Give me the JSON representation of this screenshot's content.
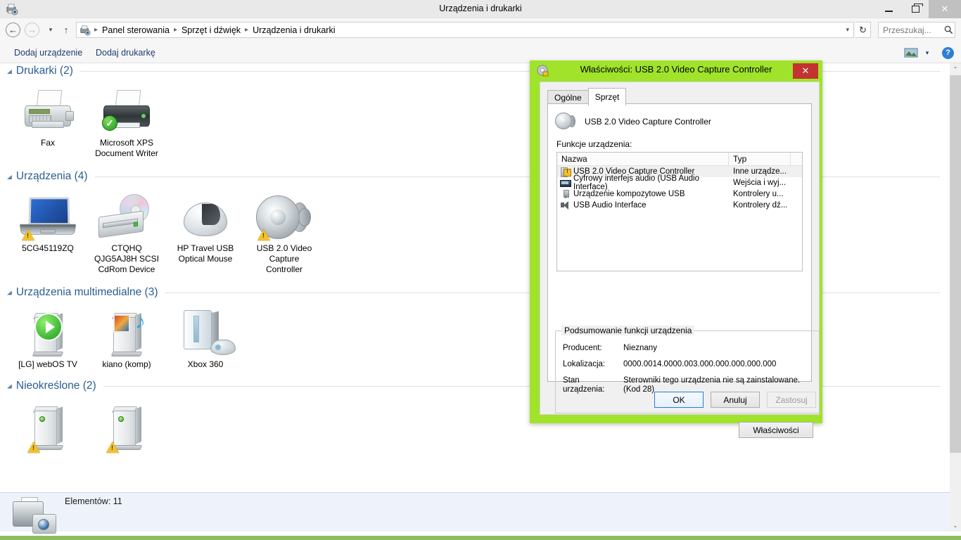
{
  "window": {
    "title": "Urządzenia i drukarki",
    "icon": "devices-printers-icon",
    "minimize": "–",
    "maximize": "❐",
    "close": "✕"
  },
  "address_bar": {
    "back": "←",
    "forward": "→",
    "recent": "▾",
    "up": "↑",
    "crumb_icon": "devices-printers-icon",
    "crumbs": [
      "Panel sterowania",
      "Sprzęt i dźwięk",
      "Urządzenia i drukarki"
    ],
    "separator": "▸",
    "dropdown_caret": "▾",
    "refresh": "↻",
    "search_placeholder": "Przeszukaj...",
    "search_value": "",
    "search_icon": "🔍"
  },
  "command_bar": {
    "add_device": "Dodaj urządzenie",
    "add_printer": "Dodaj drukarkę",
    "view_caret": "▾",
    "help": "?"
  },
  "groups": [
    {
      "title": "Drukarki (2)",
      "collapse": "◢",
      "items": [
        {
          "label": "Fax",
          "icon": "fax-printer-icon",
          "badge": "none"
        },
        {
          "label": "Microsoft XPS\nDocument Writer",
          "icon": "xps-printer-icon",
          "badge": "default-check"
        }
      ]
    },
    {
      "title": "Urządzenia (4)",
      "collapse": "◢",
      "items": [
        {
          "label": "5CG45119ZQ",
          "icon": "laptop-icon",
          "badge": "warning"
        },
        {
          "label": "CTQHQ\nQJG5AJ8H SCSI\nCdRom Device",
          "icon": "cdrom-drive-icon",
          "badge": "none"
        },
        {
          "label": "HP Travel USB\nOptical Mouse",
          "icon": "mouse-icon",
          "badge": "none"
        },
        {
          "label": "USB 2.0 Video\nCapture\nController",
          "icon": "speaker-icon",
          "badge": "warning"
        }
      ]
    },
    {
      "title": "Urządzenia multimedialne (3)",
      "collapse": "◢",
      "items": [
        {
          "label": "[LG] webOS TV",
          "icon": "media-tower-icon",
          "badge": "play"
        },
        {
          "label": "kiano (komp)",
          "icon": "media-tower-icon",
          "badge": "media"
        },
        {
          "label": "Xbox 360",
          "icon": "xbox-console-icon",
          "badge": "none"
        }
      ]
    },
    {
      "title": "Nieokreślone (2)",
      "collapse": "◢",
      "items": [
        {
          "label": "",
          "icon": "tower-icon",
          "badge": "warning"
        },
        {
          "label": "",
          "icon": "tower-icon",
          "badge": "warning"
        }
      ]
    }
  ],
  "status_bar": {
    "icon": "printer-camera-icon",
    "text": "Elementów: 11"
  },
  "scrollbar": {
    "up": "⌃",
    "down": "⌄"
  },
  "dialog": {
    "icon": "device-icon",
    "title": "Właściwości: USB 2.0 Video Capture Controller",
    "close": "✕",
    "accent_color": "#a0e32a",
    "tabs": [
      {
        "label": "Ogólne",
        "active": false
      },
      {
        "label": "Sprzęt",
        "active": true
      }
    ],
    "device_name": "USB 2.0 Video Capture Controller",
    "functions_label": "Funkcje urządzenia:",
    "columns": [
      "Nazwa",
      "Typ"
    ],
    "rows": [
      {
        "name": "USB 2.0 Video Capture Controller",
        "type": "Inne urządze...",
        "icon": "device-warning-icon",
        "selected": true
      },
      {
        "name": "Cyfrowy interfejs audio (USB Audio Interface)",
        "type": "Wejścia i wyj...",
        "icon": "audio-device-icon",
        "selected": false
      },
      {
        "name": "Urządzenie kompozytowe USB",
        "type": "Kontrolery u...",
        "icon": "usb-device-icon",
        "selected": false
      },
      {
        "name": "USB Audio Interface",
        "type": "Kontrolery dź...",
        "icon": "speaker-small-icon",
        "selected": false
      }
    ],
    "summary": {
      "legend": "Podsumowanie funkcji urządzenia",
      "manufacturer_label": "Producent:",
      "manufacturer_value": "Nieznany",
      "location_label": "Lokalizacja:",
      "location_value": "0000.0014.0000.003.000.000.000.000.000",
      "status_label": "Stan\nurządzenia:",
      "status_value": "Sterowniki tego urządzenia nie są zainstalowane. (Kod 28)"
    },
    "properties_button": "Właściwości",
    "ok_button": "OK",
    "cancel_button": "Anuluj",
    "apply_button": "Zastosuj"
  }
}
